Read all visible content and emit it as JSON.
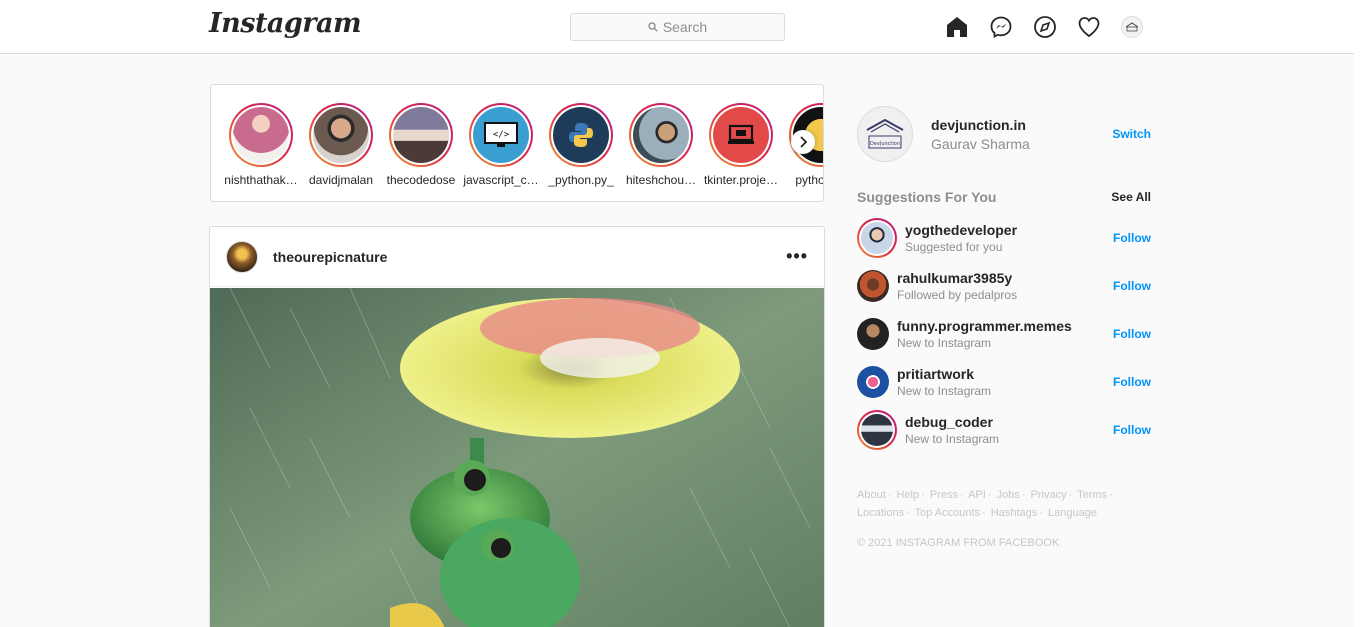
{
  "header": {
    "logo": "Instagram",
    "search_placeholder": "Search",
    "nav_icons": [
      "home-icon",
      "messenger-icon",
      "explore-icon",
      "heart-icon",
      "profile-avatar"
    ]
  },
  "stories": [
    {
      "name": "nishthathak…",
      "color": "#c86b8f"
    },
    {
      "name": "davidjmalan",
      "color": "#6b5a50"
    },
    {
      "name": "thecodedose",
      "color": "#7f7a9a"
    },
    {
      "name": "javascript_c…",
      "color": "#3a9fd0"
    },
    {
      "name": "_python.py_",
      "color": "#1f3b5a"
    },
    {
      "name": "hiteshchou…",
      "color": "#9aaebb"
    },
    {
      "name": "tkinter.proje…",
      "color": "#e24a4a"
    },
    {
      "name": "python.…",
      "color": "#f2c94c"
    }
  ],
  "post": {
    "username": "theourepicnature",
    "more_label": "•••"
  },
  "sidebar": {
    "me": {
      "username": "devjunction.in",
      "name": "Gaurav Sharma",
      "action": "Switch",
      "avatar_text": "DevJunction"
    },
    "suggestions_title": "Suggestions For You",
    "see_all": "See All",
    "suggestions": [
      {
        "username": "yogthedeveloper",
        "subtitle": "Suggested for you",
        "action": "Follow",
        "color": "#c9d6e8"
      },
      {
        "username": "rahulkumar3985y",
        "subtitle": "Followed by pedalpros",
        "action": "Follow",
        "color": "#c0562f"
      },
      {
        "username": "funny.programmer.memes",
        "subtitle": "New to Instagram",
        "action": "Follow",
        "color": "#3a3a3a"
      },
      {
        "username": "pritiartwork",
        "subtitle": "New to Instagram",
        "action": "Follow",
        "color": "#1d4fa3"
      },
      {
        "username": "debug_coder",
        "subtitle": "New to Instagram",
        "action": "Follow",
        "color": "#2e3540"
      }
    ],
    "footer_links_row1": [
      "About",
      "Help",
      "Press",
      "API",
      "Jobs",
      "Privacy",
      "Terms"
    ],
    "footer_links_row2": [
      "Locations",
      "Top Accounts",
      "Hashtags",
      "Language"
    ],
    "copyright": "© 2021 INSTAGRAM FROM FACEBOOK"
  }
}
